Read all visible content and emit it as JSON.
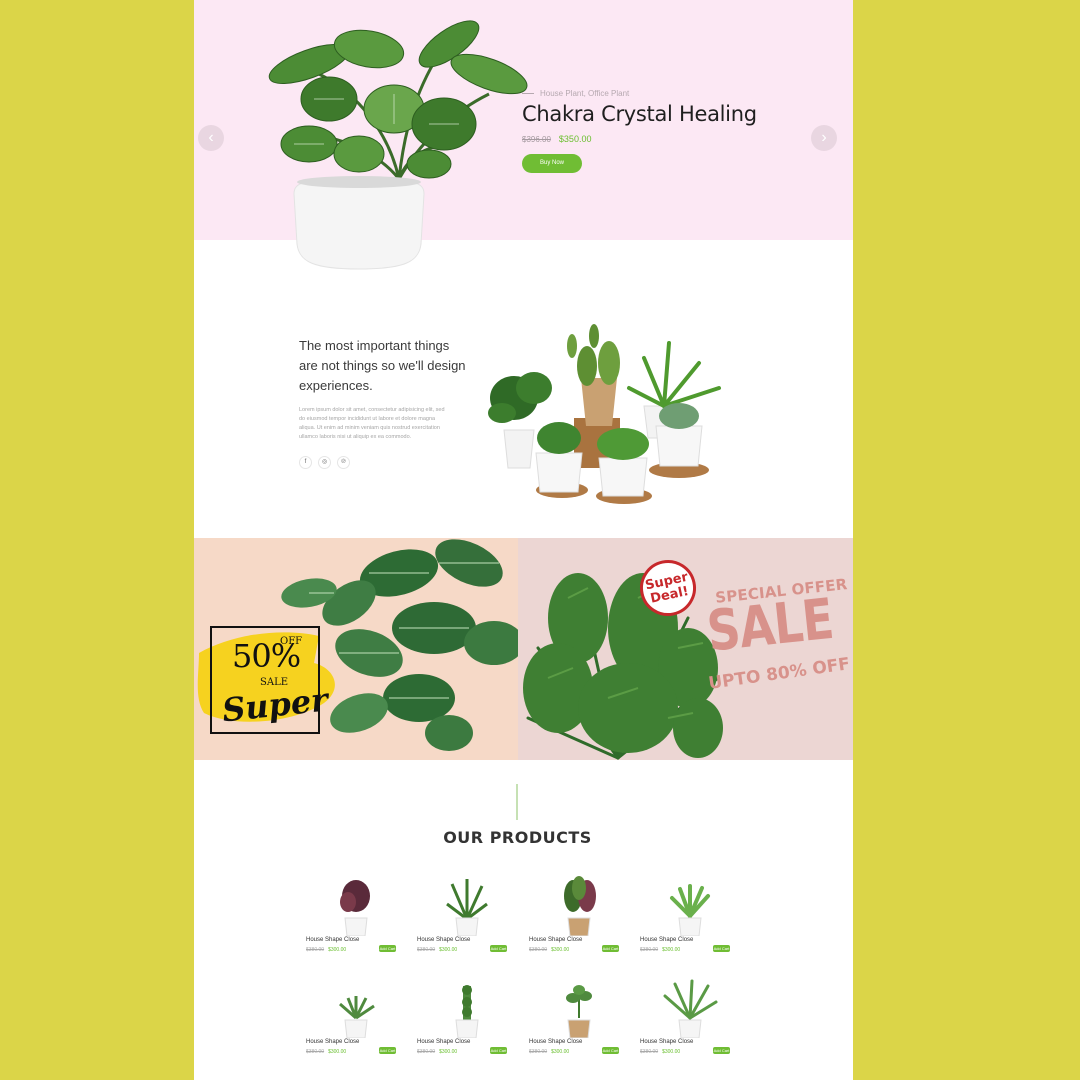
{
  "colors": {
    "page_background": "#dbd548",
    "accent_green": "#70bd34",
    "hero_background": "#fce8f4",
    "sale_pink": "#d8928b",
    "deal_red": "#c7282b"
  },
  "hero": {
    "eyebrow": "House Plant, Office Plant",
    "title": "Chakra Crystal Healing",
    "old_price": "$396.00",
    "new_price": "$350.00",
    "button_label": "Buy Now",
    "prev_icon": "‹",
    "next_icon": "›"
  },
  "about": {
    "heading": "The most important things are not things so we'll design experiences.",
    "body": "Lorem ipsum dolor sit amet, consectetur adipisicing elit, sed do eiusmod tempor incididunt ut labore et dolore magna aliqua. Ut enim ad minim veniam quis nostrud exercitation ullamco laboris nisi ut aliquip ex ea commodo.",
    "social": [
      {
        "icon": "facebook-icon",
        "glyph": "f"
      },
      {
        "icon": "instagram-icon",
        "glyph": "◎"
      },
      {
        "icon": "pinterest-icon",
        "glyph": "℗"
      }
    ]
  },
  "promo_left": {
    "percent": "50%",
    "off": "OFF",
    "sale": "SALE",
    "super": "Super"
  },
  "promo_right": {
    "badge": "Super Deal!",
    "special": "SPECIAL OFFER",
    "sale": "SALE",
    "upto": "UPTO 80% OFF"
  },
  "products": {
    "title": "OUR PRODUCTS",
    "cart_label": "Add Cart",
    "items": [
      {
        "name": "House Shape Close",
        "old_price": "$380.00",
        "new_price": "$300.00"
      },
      {
        "name": "House Shape Close",
        "old_price": "$380.00",
        "new_price": "$300.00"
      },
      {
        "name": "House Shape Close",
        "old_price": "$380.00",
        "new_price": "$300.00"
      },
      {
        "name": "House Shape Close",
        "old_price": "$380.00",
        "new_price": "$300.00"
      },
      {
        "name": "House Shape Close",
        "old_price": "$380.00",
        "new_price": "$300.00"
      },
      {
        "name": "House Shape Close",
        "old_price": "$380.00",
        "new_price": "$300.00"
      },
      {
        "name": "House Shape Close",
        "old_price": "$380.00",
        "new_price": "$300.00"
      },
      {
        "name": "House Shape Close",
        "old_price": "$380.00",
        "new_price": "$300.00"
      }
    ]
  }
}
